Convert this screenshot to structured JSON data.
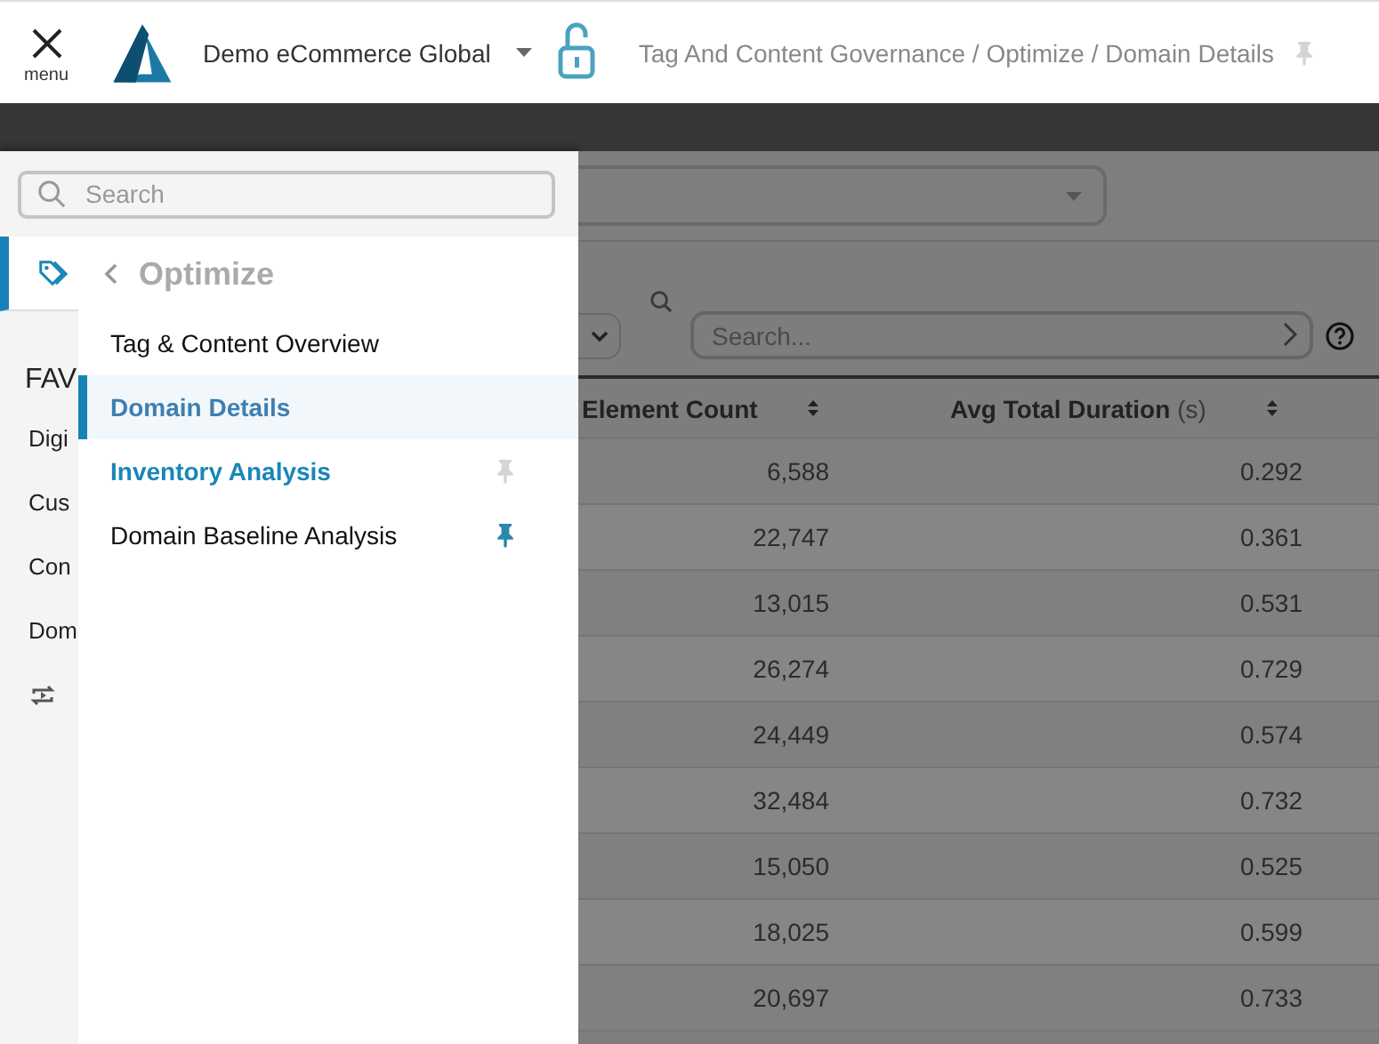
{
  "header": {
    "menu_label": "menu",
    "organization": "Demo eCommerce Global",
    "breadcrumb": "Tag And Content Governance / Optimize / Domain Details",
    "pinned": false
  },
  "sidebar": {
    "search": {
      "placeholder": "Search"
    },
    "rail": [
      {
        "kind": "tag",
        "selected": true
      }
    ],
    "favorites_heading": "FAV",
    "favorites": [
      {
        "kind": "text",
        "label": "Digi"
      },
      {
        "kind": "text",
        "label": "Cus"
      },
      {
        "kind": "text",
        "label": "Con"
      },
      {
        "kind": "text",
        "label": "Dom"
      },
      {
        "kind": "repeat"
      }
    ]
  },
  "flyout": {
    "title": "Optimize",
    "items": [
      {
        "label": "Tag & Content Overview",
        "selected": false,
        "highlighted": false
      },
      {
        "label": "Domain Details",
        "selected": true,
        "highlighted": false
      },
      {
        "label": "Inventory Analysis",
        "selected": false,
        "highlighted": true,
        "pinned": false
      },
      {
        "label": "Domain Baseline Analysis",
        "selected": false,
        "highlighted": false,
        "pinned": true
      }
    ]
  },
  "content": {
    "table_search": {
      "placeholder": "Search..."
    },
    "columns": [
      {
        "label": "Element Count"
      },
      {
        "label": "Avg Total Duration",
        "unit": "(s)"
      }
    ],
    "rows": [
      [
        "6,588",
        "0.292"
      ],
      [
        "22,747",
        "0.361"
      ],
      [
        "13,015",
        "0.531"
      ],
      [
        "26,274",
        "0.729"
      ],
      [
        "24,449",
        "0.574"
      ],
      [
        "32,484",
        "0.732"
      ],
      [
        "15,050",
        "0.525"
      ],
      [
        "18,025",
        "0.599"
      ],
      [
        "20,697",
        "0.733"
      ]
    ]
  }
}
